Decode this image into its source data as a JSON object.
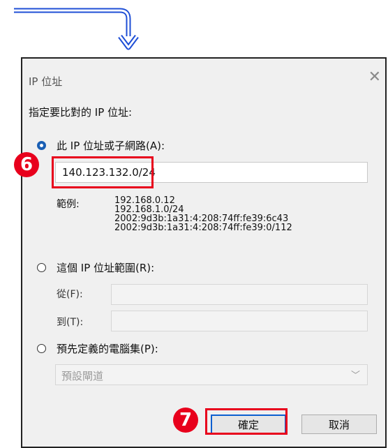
{
  "dialog": {
    "title": "IP 位址",
    "close_glyph": "✕",
    "prompt": "指定要比對的 IP 位址:"
  },
  "option_subnet": {
    "label": "此 IP 位址或子網路(A):",
    "checked": true,
    "value": "140.123.132.0/24"
  },
  "examples": {
    "label": "範例:",
    "lines": [
      "192.168.0.12",
      "192.168.1.0/24",
      "2002:9d3b:1a31:4:208:74ff:fe39:6c43",
      "2002:9d3b:1a31:4:208:74ff:fe39:0/112"
    ]
  },
  "option_range": {
    "label": "這個 IP 位址範圍(R):",
    "checked": false,
    "from_label": "從(F):",
    "from_value": "",
    "to_label": "到(T):",
    "to_value": ""
  },
  "option_predefined": {
    "label": "預先定義的電腦集(P):",
    "checked": false,
    "selected": "預設閘道"
  },
  "buttons": {
    "ok": "確定",
    "cancel": "取消"
  },
  "annotations": {
    "step_a": "6",
    "step_b": "7",
    "highlight_color": "#e8001c",
    "arrow_color": "#1f4fd6"
  }
}
